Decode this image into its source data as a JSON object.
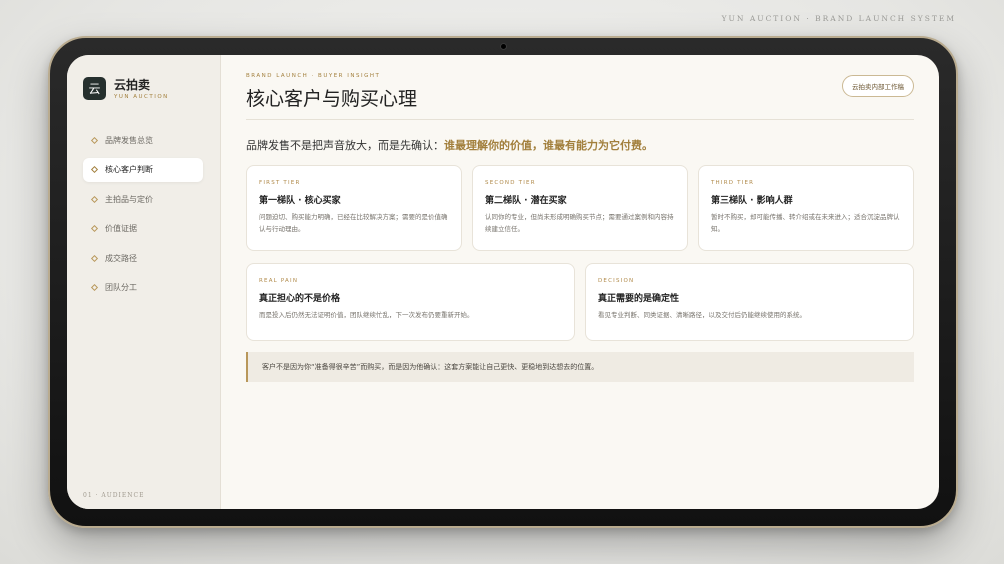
{
  "top_caption": "YUN AUCTION · BRAND LAUNCH SYSTEM",
  "sidebar": {
    "logo_glyph": "云",
    "brand_name": "云拍卖",
    "brand_sub": "YUN AUCTION",
    "items": [
      {
        "label": "品牌发售总览"
      },
      {
        "label": "核心客户判断"
      },
      {
        "label": "主拍品与定价"
      },
      {
        "label": "价值证据"
      },
      {
        "label": "成交路径"
      },
      {
        "label": "团队分工"
      }
    ],
    "active_index": 1,
    "footer": "01 · AUDIENCE"
  },
  "header": {
    "eyebrow": "BRAND LAUNCH · BUYER INSIGHT",
    "title": "核心客户与购买心理",
    "badge": "云拍卖内部工作稿"
  },
  "lead": {
    "prefix": "品牌发售不是把声音放大，而是先确认：",
    "highlight": "谁最理解你的价值，谁最有能力为它付费。"
  },
  "tiers": [
    {
      "tag": "FIRST TIER",
      "title": "第一梯队 · 核心买家",
      "desc": "问题迫切、购买能力明确，已经在比较解决方案；需要的是价值确认与行动理由。"
    },
    {
      "tag": "SECOND TIER",
      "title": "第二梯队 · 潜在买家",
      "desc": "认同你的专业，但尚未形成明确购买节点；需要通过案例和内容持续建立信任。"
    },
    {
      "tag": "THIRD TIER",
      "title": "第三梯队 · 影响人群",
      "desc": "暂时不购买，却可能传播、转介绍或在未来进入；适合沉淀品牌认知。"
    }
  ],
  "insights": [
    {
      "tag": "REAL PAIN",
      "title": "真正担心的不是价格",
      "desc": "而是投入后仍然无法证明价值，团队继续忙乱，下一次发布仍要重新开始。"
    },
    {
      "tag": "DECISION",
      "title": "真正需要的是确定性",
      "desc": "看见专业判断、同类证据、清晰路径，以及交付后仍能继续使用的系统。"
    }
  ],
  "note": "客户不是因为你“准备得很辛苦”而购买，而是因为他确认：这套方案能让自己更快、更稳地到达想去的位置。",
  "colors": {
    "accent": "#a27f3c",
    "paper": "#faf8f3",
    "sidebar": "#f1eee8"
  }
}
